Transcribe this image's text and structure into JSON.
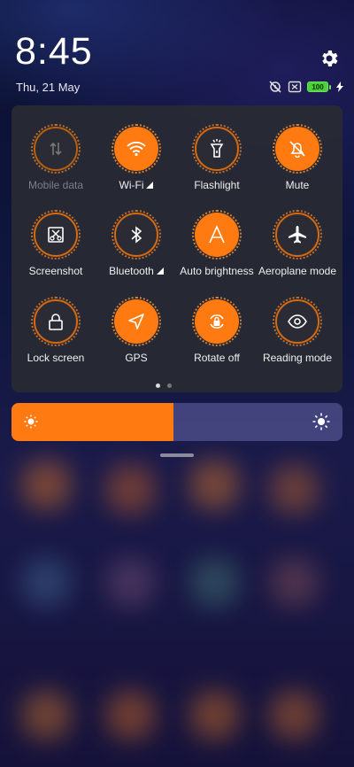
{
  "status_bar": {
    "time": "8:45",
    "date": "Thu, 21 May",
    "battery_level": "100",
    "icons": [
      "alarm-off-icon",
      "no-sim-icon",
      "battery-icon",
      "charging-icon"
    ]
  },
  "settings_icon": "gear-icon",
  "toggles": [
    {
      "label": "Mobile data",
      "state": "disabled",
      "icon": "mobile-data-icon"
    },
    {
      "label": "Wi-Fi",
      "state": "on",
      "icon": "wifi-icon",
      "signal_indicator": true
    },
    {
      "label": "Flashlight",
      "state": "off",
      "icon": "flashlight-icon"
    },
    {
      "label": "Mute",
      "state": "on",
      "icon": "bell-off-icon"
    },
    {
      "label": "Screenshot",
      "state": "off",
      "icon": "screenshot-icon"
    },
    {
      "label": "Bluetooth",
      "state": "off",
      "icon": "bluetooth-icon",
      "signal_indicator": true
    },
    {
      "label": "Auto brightness",
      "state": "on",
      "icon": "auto-brightness-icon"
    },
    {
      "label": "Aeroplane mode",
      "state": "off",
      "icon": "airplane-icon"
    },
    {
      "label": "Lock screen",
      "state": "off",
      "icon": "lock-icon"
    },
    {
      "label": "GPS",
      "state": "on",
      "icon": "location-arrow-icon"
    },
    {
      "label": "Rotate off",
      "state": "on",
      "icon": "rotate-lock-icon"
    },
    {
      "label": "Reading mode",
      "state": "off",
      "icon": "eye-icon"
    }
  ],
  "pager": {
    "pages": 2,
    "active": 1
  },
  "brightness": {
    "level_fraction": 0.49
  },
  "colors": {
    "accent": "#ff7a10",
    "panel": "#282a34",
    "tile_off": "#2a2b35"
  }
}
